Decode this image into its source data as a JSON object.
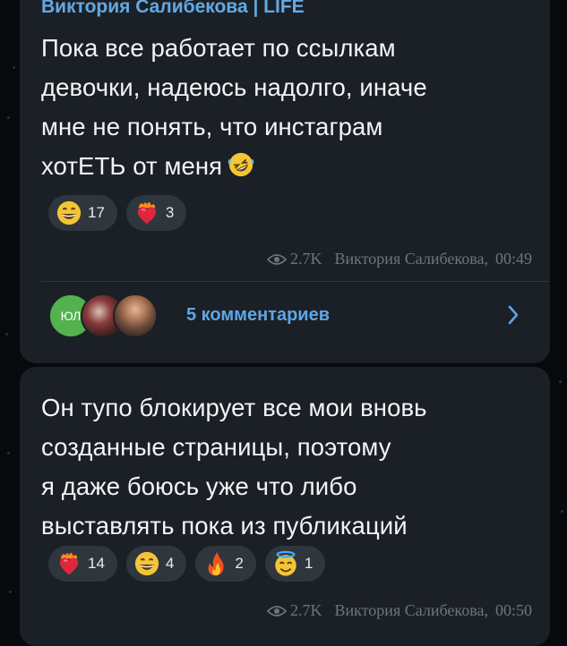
{
  "messages": [
    {
      "author": "Виктория Салибекова | LIFE",
      "text": "Пока все работает по ссылкам\nдевочки, надеюсь надолго, иначе\nмне не понять, что инстаграм\nхотЕТЬ от меня",
      "inline_emoji": "rofl-emoji",
      "reactions": [
        {
          "icon": "grinning-face-icon",
          "count": "17"
        },
        {
          "icon": "heart-on-fire-icon",
          "count": "3"
        }
      ],
      "views": "2.7K",
      "signature": "Виктория Салибекова,",
      "time": "00:49",
      "comments_label": "5 комментариев",
      "avatar_initials": "ЮЛ"
    },
    {
      "text": "Он тупо блокирует все мои вновь\nсозданные страницы, поэтому\nя даже боюсь уже что либо\nвыставлять пока из публикаций",
      "reactions": [
        {
          "icon": "heart-on-fire-icon",
          "count": "14"
        },
        {
          "icon": "grinning-face-icon",
          "count": "4"
        },
        {
          "icon": "fire-icon",
          "count": "2"
        },
        {
          "icon": "halo-face-icon",
          "count": "1"
        }
      ],
      "views": "2.7K",
      "signature": "Виктория Салибекова,",
      "time": "00:50"
    }
  ],
  "colors": {
    "background": "#07090c",
    "bubble": "#1b2026",
    "accent": "#63a9e4",
    "reaction_pill": "#2f363e",
    "meta": "#6c7681"
  }
}
